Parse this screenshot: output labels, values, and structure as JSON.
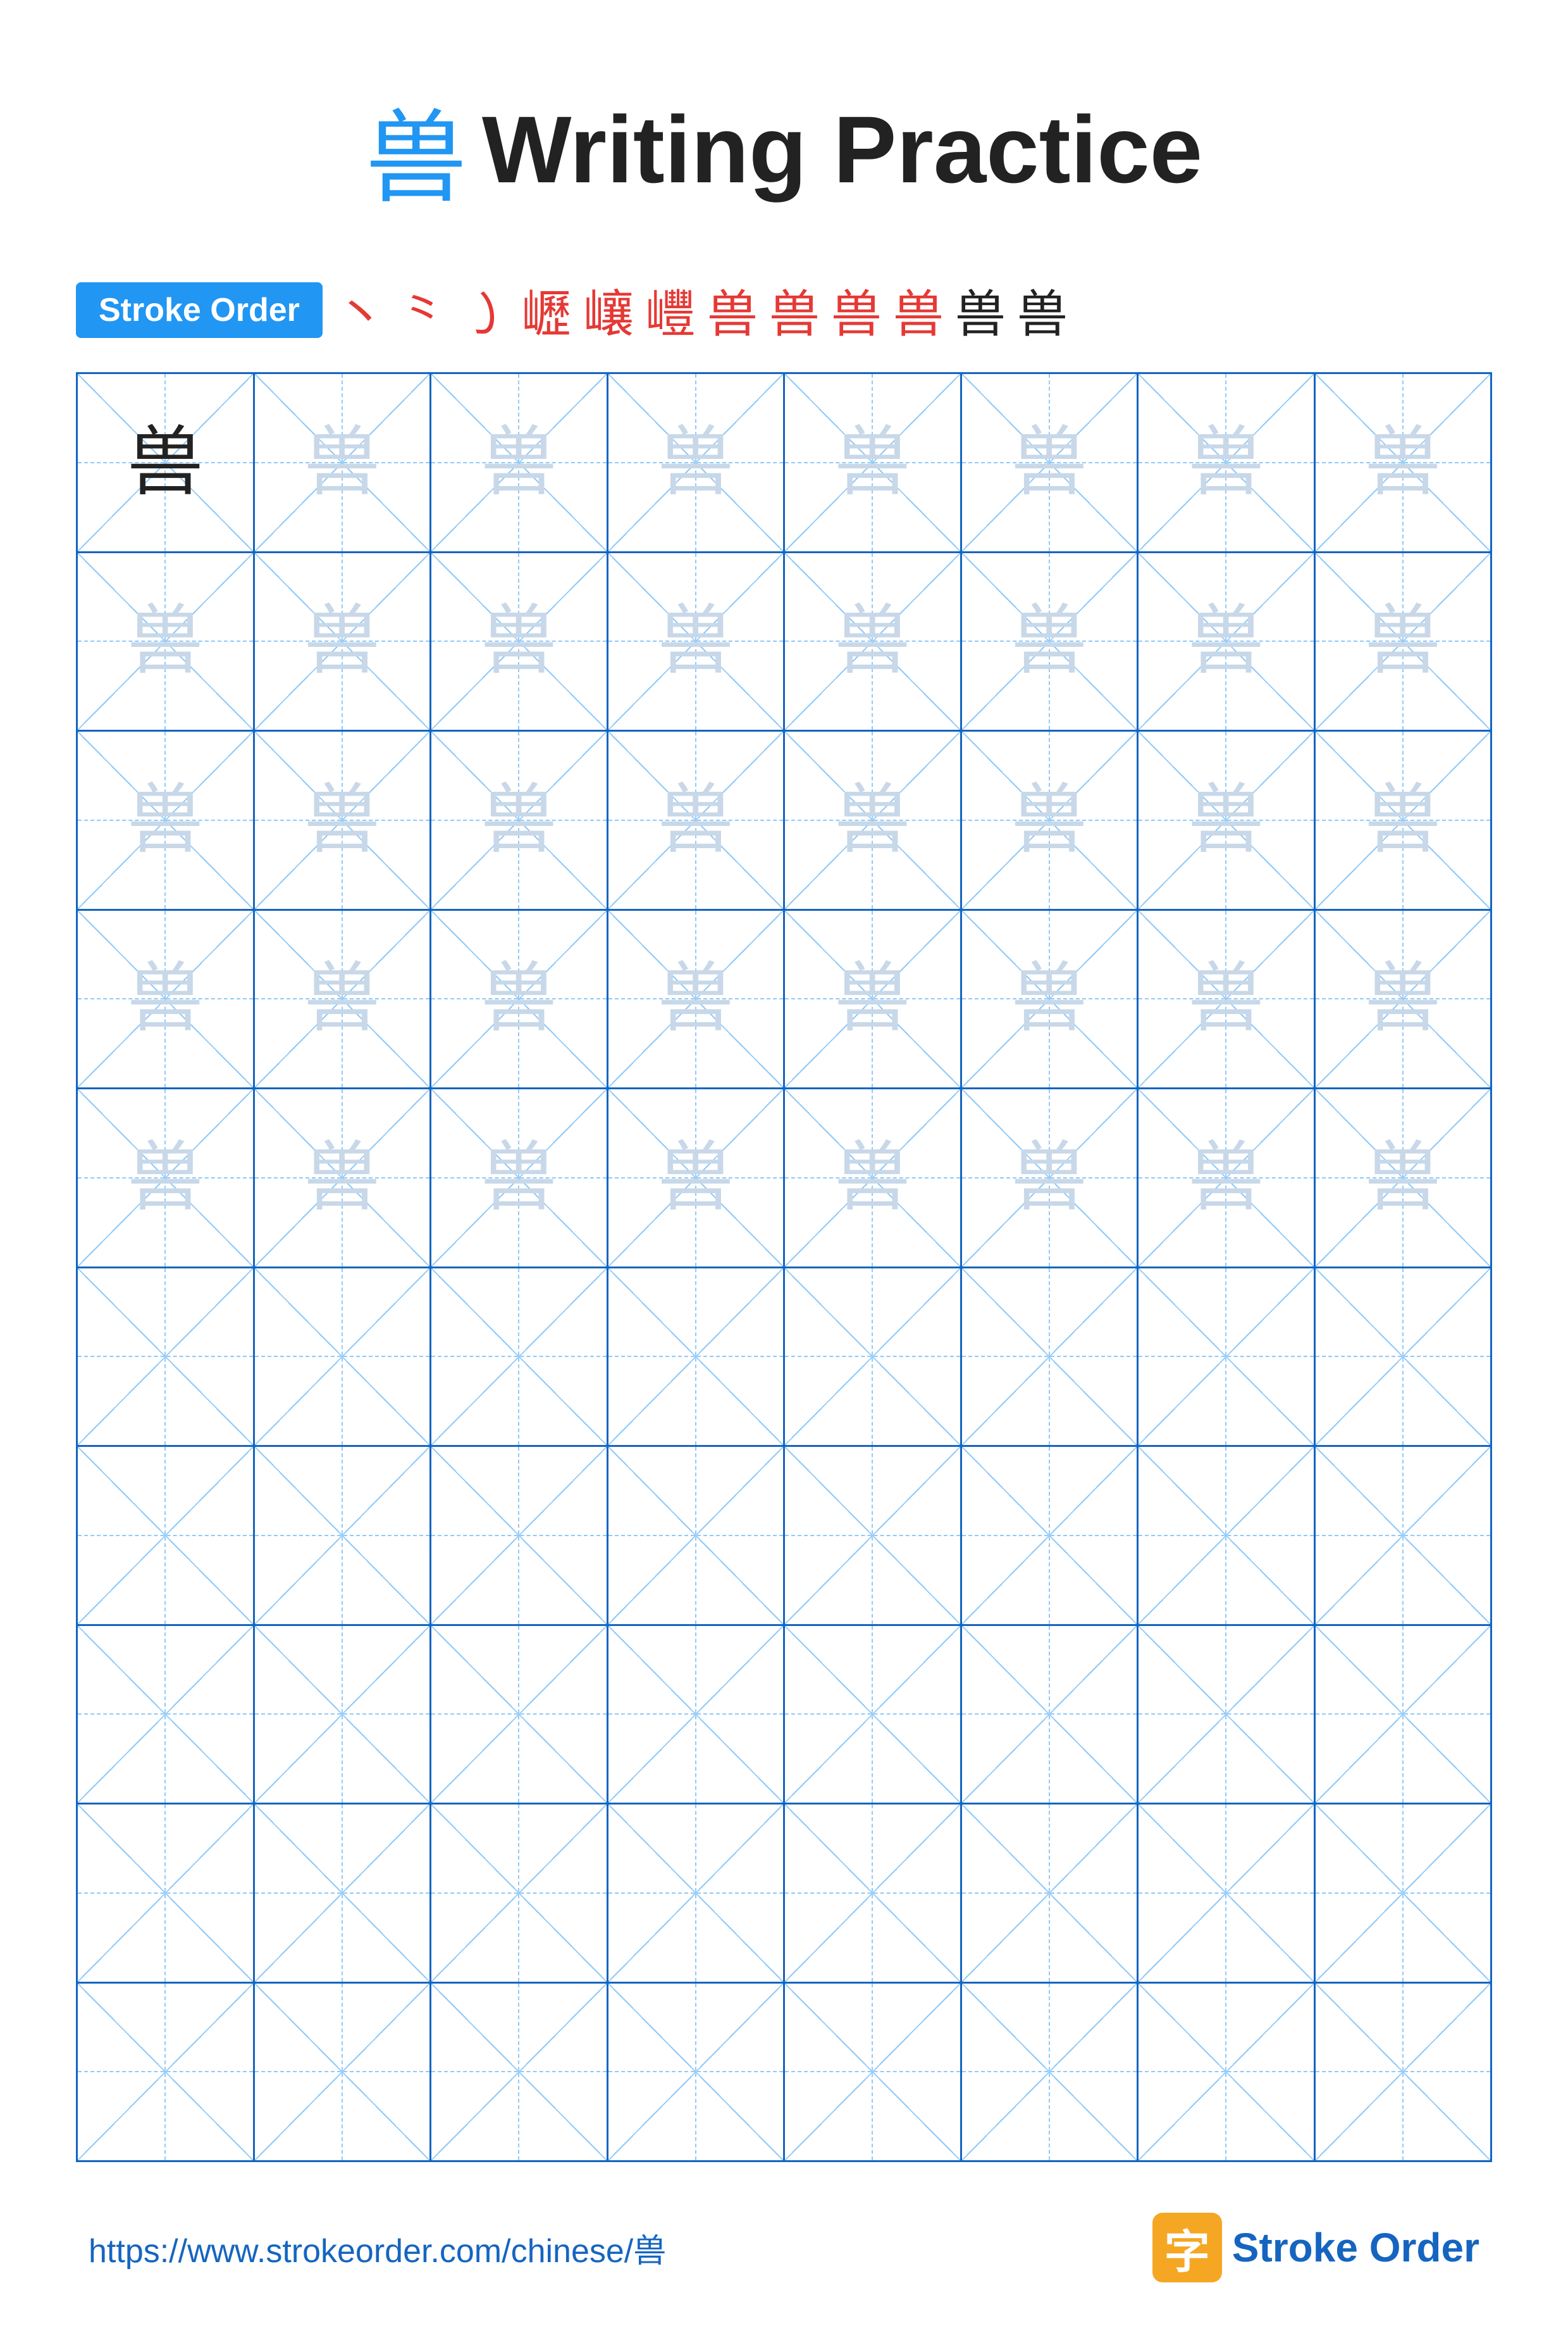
{
  "title": {
    "char": "兽",
    "text": "Writing Practice"
  },
  "stroke_order": {
    "badge": "Stroke Order",
    "steps": [
      "丶",
      "㇀",
      "㇁",
      "㠣",
      "㠤",
      "㠦",
      "㤉",
      "兽",
      "兽",
      "兽",
      "兽",
      "兽"
    ]
  },
  "grid": {
    "rows": 10,
    "cols": 8,
    "char": "兽",
    "filled_rows": 5,
    "empty_rows": 5
  },
  "footer": {
    "url": "https://www.strokeorder.com/chinese/兽",
    "logo_char": "字",
    "logo_text_stroke": "Stroke",
    "logo_text_order": "Order"
  }
}
